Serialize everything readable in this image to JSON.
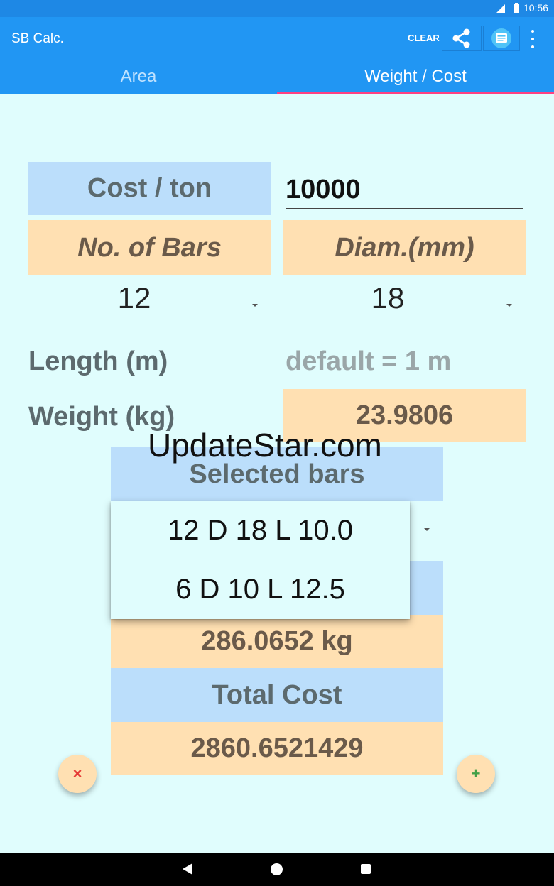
{
  "status_bar": {
    "time": "10:56",
    "network": "4G"
  },
  "app_bar": {
    "title": "SB Calc.",
    "clear_label": "CLEAR",
    "share_icon": "share-icon",
    "note_icon": "message-icon",
    "more_icon": "more-vert-icon"
  },
  "tabs": [
    {
      "label": "Area",
      "selected": false
    },
    {
      "label": "Weight / Cost",
      "selected": true
    }
  ],
  "form": {
    "cost_label": "Cost / ton",
    "cost_value": "10000",
    "bars_label": "No. of Bars",
    "diam_label": "Diam.(mm)",
    "bars_value": "12",
    "diam_value": "18",
    "length_label": "Length (m)",
    "length_placeholder": "default = 1 m",
    "weight_label": "Weight (kg)",
    "weight_value": "23.9806"
  },
  "watermark": "UpdateStar.com",
  "selected": {
    "label": "Selected bars",
    "options": [
      "12 D 18 L 10.0",
      "6 D 10 L 12.5"
    ]
  },
  "totals": {
    "weight_value": "286.0652 kg",
    "cost_label": "Total Cost",
    "cost_value": "2860.6521429"
  },
  "fabs": {
    "delete_symbol": "×",
    "add_symbol": "+"
  },
  "colors": {
    "primary": "#2196f3",
    "accent": "#ff4081",
    "background": "#e0fdfd",
    "label_blue": "#bbdefb",
    "label_peach": "#ffe0b2"
  }
}
